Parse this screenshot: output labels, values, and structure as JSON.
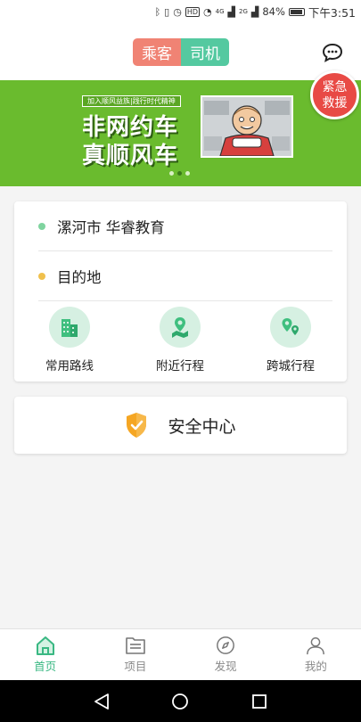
{
  "status_bar": {
    "network_4g": "4G",
    "hd_label": "HD",
    "network_2g": "2G",
    "battery": "84%",
    "time": "下午3:51"
  },
  "header": {
    "passenger_tab": "乘客",
    "driver_tab": "司机",
    "message_icon": "chat-bubble-icon",
    "colors": {
      "passenger": "#f08374",
      "driver": "#54c9a0"
    }
  },
  "emergency": {
    "line1": "紧急",
    "line2": "救援"
  },
  "banner": {
    "tagline": "加入顺风益族|践行时代精神",
    "title_line1": "非网约车",
    "title_line2": "真顺风车",
    "page_count": 3,
    "active_page": 2,
    "color": "#6abb2e"
  },
  "trip": {
    "origin": "漯河市 华睿教育",
    "destination": "目的地",
    "origin_dot_color": "#7fd49f",
    "destination_dot_color": "#f0c04c",
    "quick_actions": [
      {
        "label": "常用路线",
        "icon": "buildings-icon"
      },
      {
        "label": "附近行程",
        "icon": "map-pin-icon"
      },
      {
        "label": "跨城行程",
        "icon": "route-pins-icon"
      }
    ]
  },
  "safety": {
    "label": "安全中心",
    "icon": "shield-check-icon"
  },
  "bottom_nav": [
    {
      "label": "首页",
      "icon": "home-icon",
      "active": true
    },
    {
      "label": "项目",
      "icon": "folder-list-icon",
      "active": false
    },
    {
      "label": "发现",
      "icon": "compass-icon",
      "active": false
    },
    {
      "label": "我的",
      "icon": "user-icon",
      "active": false
    }
  ],
  "accent_color": "#3ab883"
}
